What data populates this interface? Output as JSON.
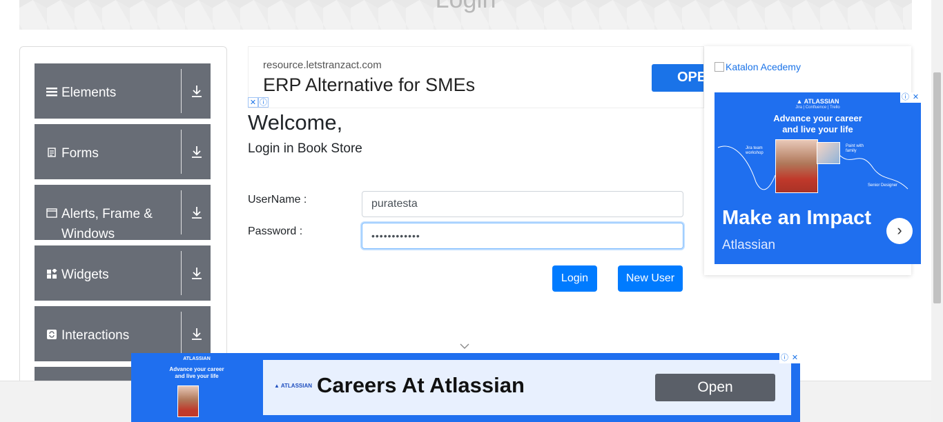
{
  "header": {
    "title": "Login"
  },
  "sidebar": {
    "groups": [
      {
        "label": "Elements",
        "icon": "hamburger-icon"
      },
      {
        "label": "Forms",
        "icon": "document-icon"
      },
      {
        "label": "Alerts, Frame & Windows",
        "icon": "window-icon"
      },
      {
        "label": "Widgets",
        "icon": "widgets-icon"
      },
      {
        "label": "Interactions",
        "icon": "interactions-icon"
      }
    ]
  },
  "ad_top": {
    "url": "resource.letstranzact.com",
    "headline": "ERP Alternative for SMEs",
    "button": "OPE"
  },
  "login": {
    "welcome": "Welcome,",
    "subtitle": "Login in Book Store",
    "username_label": "UserName :",
    "username_value": "puratesta",
    "password_label": "Password :",
    "password_value": "••••••••••••",
    "login_button": "Login",
    "new_user_button": "New User"
  },
  "ad_right": {
    "katalon_alt": "Katalon Acedemy",
    "brand": "ATLASSIAN",
    "brand_products": "Jira | Confluence | Trello",
    "tagline_1": "Advance your career",
    "tagline_2": "and live your life",
    "note_1": "Jira team workshop",
    "note_2": "Paint with family",
    "note_3": "Senior Designer",
    "headline": "Make an Impact",
    "advertiser": "Atlassian"
  },
  "ad_bottom": {
    "brand": "ATLASSIAN",
    "thumb_tagline_1": "Advance your career",
    "thumb_tagline_2": "and live your life",
    "headline": "Careers At Atlassian",
    "button": "Open"
  },
  "colors": {
    "sidebar_group_bg": "#686d76",
    "primary_button": "#007bff",
    "atlassian_blue": "#1f6fef"
  }
}
